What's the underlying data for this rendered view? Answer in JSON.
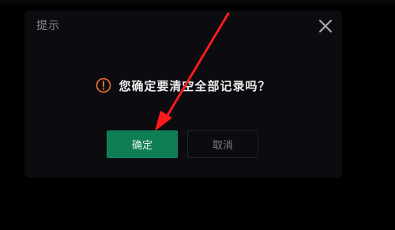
{
  "dialog": {
    "title": "提示",
    "close_icon": "close-icon",
    "warning_icon": "warning-circle-icon",
    "message": "您确定要清空全部记录吗？",
    "confirm_label": "确定",
    "cancel_label": "取消"
  },
  "colors": {
    "page_background": "#000000",
    "dialog_background": "#0b0b10",
    "confirm_button": "#0f7e54",
    "warning_icon": "#e06a2e",
    "annotation_arrow": "#ff1a1a"
  },
  "annotation": {
    "type": "arrow",
    "color": "#ff1a1a"
  }
}
